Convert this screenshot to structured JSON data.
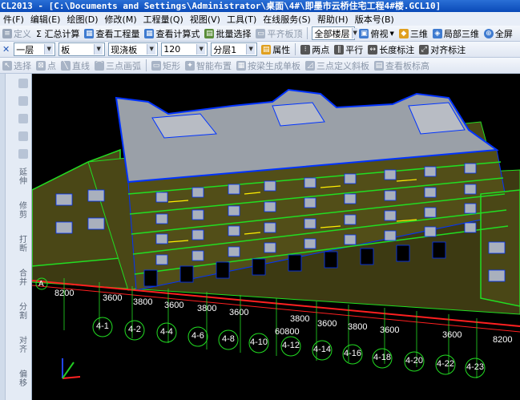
{
  "window": {
    "title": "CL2013 - [C:\\Documents and Settings\\Administrator\\桌面\\4#\\即墨市云桥住宅工程4#楼.GCL10]"
  },
  "menu": [
    "件(F)",
    "编辑(E)",
    "绘图(D)",
    "修改(M)",
    "工程量(Q)",
    "视图(V)",
    "工具(T)",
    "在线服务(S)",
    "帮助(H)",
    "版本号(B)"
  ],
  "toolbar1": {
    "define": "定义",
    "sum": "Σ 汇总计算",
    "view_qty": "查看工程量",
    "view_formula": "查看计算式",
    "batch_select": "批量选择",
    "flat_board": "平齐板顶",
    "floor_select": "全部楼层",
    "view_mode": "俯视",
    "three_d": "三维",
    "local_3d": "局部三维",
    "fullscreen": "全屏"
  },
  "toolbar2": {
    "floor": "一层",
    "category": "板",
    "type": "现浇板",
    "thickness": "120",
    "layer": "分层1",
    "props": "属性",
    "two_points": "两点",
    "parallel": "平行",
    "length_dim": "长度标注",
    "align_dim": "对齐标注"
  },
  "toolbar3": {
    "select": "选择",
    "point": "点",
    "line": "直线",
    "arc3": "三点画弧",
    "rect": "矩形",
    "smart": "智能布置",
    "auto_gen": "按梁生成单板",
    "slope3": "三点定义斜板",
    "view_slab": "查看板标高"
  },
  "sidebar": {
    "items": [
      "延伸",
      "修剪",
      "打断",
      "合并",
      "分割",
      "对齐",
      "偏移"
    ]
  },
  "dims": {
    "row1": [
      "8200",
      "3600",
      "3800",
      "3600",
      "3800",
      "3600"
    ],
    "row1b": [
      "3800",
      "3600",
      "3800",
      "3600"
    ],
    "row1c": [
      "3600",
      "8200"
    ],
    "total": "60800"
  },
  "axes": [
    "4-1",
    "4-2",
    "4-4",
    "4-6",
    "4-8",
    "4-10",
    "4-12",
    "4-14",
    "4-16",
    "4-18",
    "4-20",
    "4-22",
    "4-23"
  ],
  "axis_letter": "A",
  "colors": {
    "title": "#0a4ab8",
    "wall": "#3d3a12",
    "slab_edge": "#0033ff",
    "slab_green": "#22dd22",
    "roof": "#9aa0a8"
  }
}
